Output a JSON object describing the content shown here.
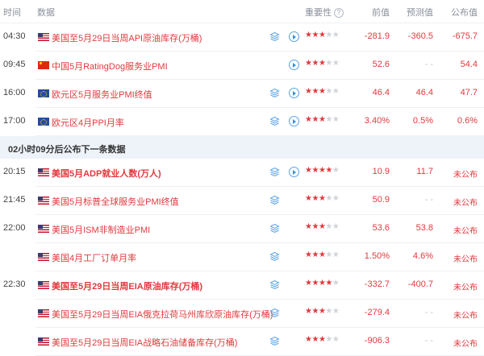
{
  "header": {
    "time": "时间",
    "data": "数据",
    "importance": "重要性",
    "help": "?",
    "previous": "前值",
    "forecast": "预测值",
    "actual": "公布值"
  },
  "rows": [
    {
      "time": "04:30",
      "flag": "us",
      "title": "美国至5月29日当周API原油库存(万桶)",
      "bold": false,
      "icons": [
        "layers-icon",
        "play-icon"
      ],
      "stars": 3,
      "previous": "-281.9",
      "forecast": "-360.5",
      "actual": "-675.7"
    },
    {
      "time": "09:45",
      "flag": "cn",
      "title": "中国5月RatingDog服务业PMI",
      "bold": false,
      "icons": [
        "play-icon"
      ],
      "stars": 3,
      "previous": "52.6",
      "forecast": "- -",
      "actual": "54.4"
    },
    {
      "time": "16:00",
      "flag": "eu",
      "title": "欧元区5月服务业PMI终值",
      "bold": false,
      "icons": [
        "layers-icon",
        "play-icon"
      ],
      "stars": 3,
      "previous": "46.4",
      "forecast": "46.4",
      "actual": "47.7"
    },
    {
      "time": "17:00",
      "flag": "eu",
      "title": "欧元区4月PPI月率",
      "bold": false,
      "icons": [
        "layers-icon",
        "play-icon"
      ],
      "stars": 3,
      "previous": "3.40%",
      "forecast": "0.5%",
      "actual": "0.6%"
    }
  ],
  "banner": "02小时09分后公布下一条数据",
  "rows2": [
    {
      "time": "20:15",
      "flag": "us",
      "title": "美国5月ADP就业人数(万人)",
      "bold": true,
      "icons": [
        "layers-icon",
        "play-icon"
      ],
      "stars": 4,
      "previous": "10.9",
      "forecast": "11.7",
      "actual": "未公布"
    },
    {
      "time": "21:45",
      "flag": "us",
      "title": "美国5月标普全球服务业PMI终值",
      "bold": false,
      "icons": [
        "layers-icon"
      ],
      "stars": 3,
      "previous": "50.9",
      "forecast": "- -",
      "actual": "未公布"
    },
    {
      "time": "22:00",
      "flag": "us",
      "title": "美国5月ISM非制造业PMI",
      "bold": false,
      "icons": [
        "layers-icon"
      ],
      "stars": 3,
      "previous": "53.6",
      "forecast": "53.8",
      "actual": "未公布"
    },
    {
      "time": "",
      "flag": "us",
      "title": "美国4月工厂订单月率",
      "bold": false,
      "icons": [
        "layers-icon"
      ],
      "stars": 3,
      "previous": "1.50%",
      "forecast": "4.6%",
      "actual": "未公布"
    },
    {
      "time": "22:30",
      "flag": "us",
      "title": "美国至5月29日当周EIA原油库存(万桶)",
      "bold": true,
      "icons": [
        "layers-icon"
      ],
      "stars": 4,
      "previous": "-332.7",
      "forecast": "-400.7",
      "actual": "未公布"
    },
    {
      "time": "",
      "flag": "us",
      "title": "美国至5月29日当周EIA俄克拉荷马州库欣原油库存(万桶)",
      "bold": false,
      "icons": [
        "layers-icon"
      ],
      "stars": 3,
      "previous": "-279.4",
      "forecast": "- -",
      "actual": "未公布"
    },
    {
      "time": "",
      "flag": "us",
      "title": "美国至5月29日当周EIA战略石油储备库存(万桶)",
      "bold": false,
      "icons": [
        "layers-icon"
      ],
      "stars": 3,
      "previous": "-906.3",
      "forecast": "- -",
      "actual": "未公布"
    }
  ],
  "colors": {
    "accent": "#e0393e",
    "muted": "#8a8f99",
    "banner_bg": "#eef3fa",
    "icon_blue": "#3b8de0"
  }
}
